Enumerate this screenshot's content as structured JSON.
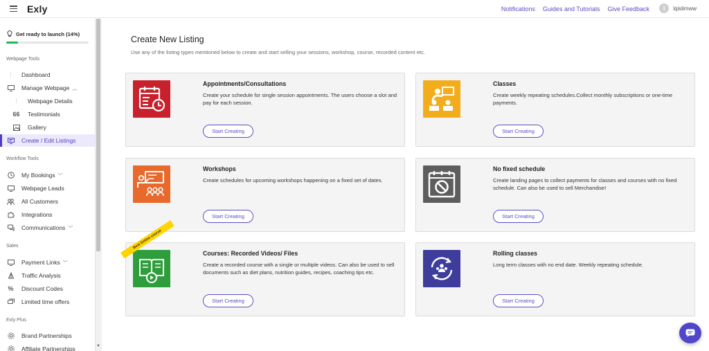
{
  "app": {
    "brand": "Exly"
  },
  "topbar": {
    "links": [
      "Notifications",
      "Guides and Tutorials",
      "Give Feedback"
    ],
    "avatar_initial": "I",
    "username": "lqislimww"
  },
  "launch": {
    "label": "Get ready to launch (14%)",
    "progress": 0.14
  },
  "sidebar": {
    "sections": {
      "webpage_tools": "Webpage Tools",
      "workflow_tools": "Workflow Tools",
      "sales": "Sales",
      "exly_plus": "Exly Plus"
    },
    "items": {
      "dashboard": "Dashboard",
      "manage_webpage": "Manage Webpage",
      "webpage_details": "Webpage Details",
      "testimonials": "Testimonials",
      "gallery": "Gallery",
      "create_edit_listings": "Create / Edit Listings",
      "my_bookings": "My Bookings",
      "webpage_leads": "Webpage Leads",
      "all_customers": "All Customers",
      "integrations": "Integrations",
      "communications": "Communications",
      "payment_links": "Payment Links",
      "traffic_analysis": "Traffic Analysis",
      "discount_codes": "Discount Codes",
      "limited_time_offers": "Limited time offers",
      "brand_partnerships": "Brand Partnerships",
      "affiliate_partnerships": "Affiliate Partnerships"
    }
  },
  "main": {
    "title": "Create New Listing",
    "subtitle": "Use any of the listing types mentioned below to create and start selling your sessions, workshop, course, recorded content etc.",
    "start_label": "Start Creating",
    "ribbon_text": "Best Online course",
    "cards": [
      {
        "title": "Appointments/Consultations",
        "desc": "Create your schedule for single session appointments. The users choose a slot and pay for each session."
      },
      {
        "title": "Classes",
        "desc": "Create weekly repeating schedules.Collect monthly subscriptions or one-time payments."
      },
      {
        "title": "Workshops",
        "desc": "Create schedules for upcoming workshops happening on a fixed set of dates."
      },
      {
        "title": "No fixed schedule",
        "desc": "Create landing pages to collect payments for classes and courses with no fixed schedule. Can also be used to sell Merchandise!"
      },
      {
        "title": "Courses: Recorded Videos/ Files",
        "desc": "Create a recorded course with a single or multiple videos. Can also be used to sell documents such as diet plans, nutrition guides, recipes, coaching tips etc."
      },
      {
        "title": "Rolling classes",
        "desc": "Long term classes with no end date. Weekly repeating schedule."
      }
    ]
  },
  "colors": {
    "accent": "#5b4ec2",
    "appointments": "#c8202c",
    "classes": "#f2ac1c",
    "workshops": "#e8692c",
    "no_fixed": "#5d5d5d",
    "courses": "#2e9e3c",
    "rolling": "#3e3d9c"
  }
}
